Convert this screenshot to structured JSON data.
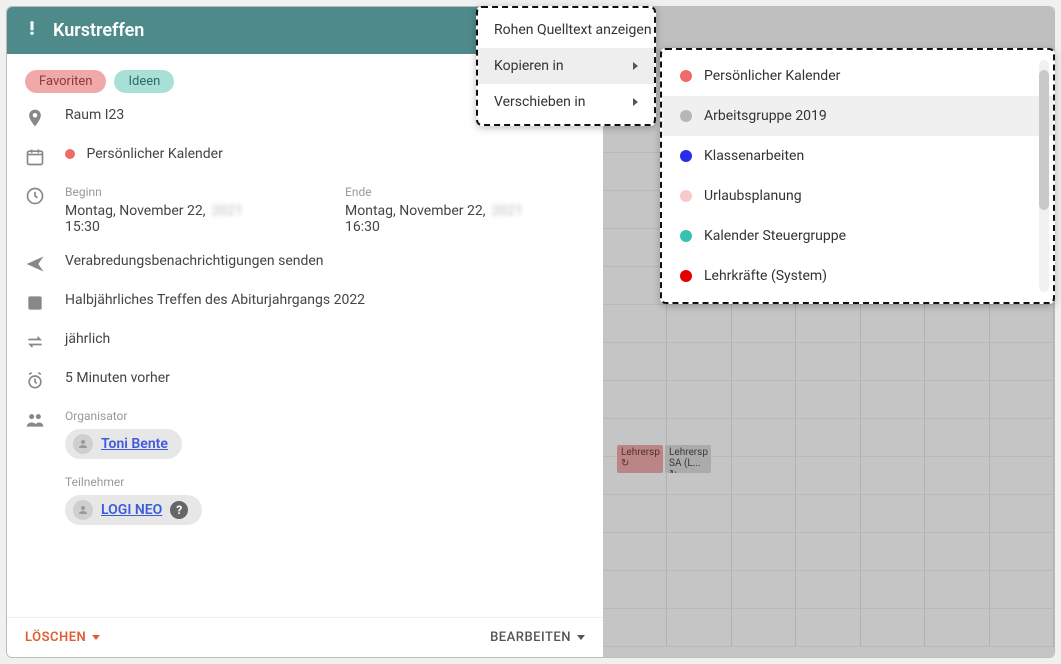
{
  "header": {
    "title": "Kurstreffen"
  },
  "tags": {
    "fav": "Favoriten",
    "idea": "Ideen"
  },
  "location": "Raum I23",
  "calendar": {
    "name": "Persönlicher Kalender",
    "color": "#f06a6a"
  },
  "time": {
    "begin_label": "Beginn",
    "end_label": "Ende",
    "begin_date": "Montag, November 22,",
    "begin_year_obscured": "2021",
    "begin_time": "15:30",
    "end_date": "Montag, November 22,",
    "end_year_obscured": "2021",
    "end_time": "16:30"
  },
  "notify_text": "Verabredungsbenachrichtigungen senden",
  "description": "Halbjährliches Treffen des Abiturjahrgangs 2022",
  "recurrence": "jährlich",
  "alarm": "5 Minuten vorher",
  "organizer_label": "Organisator",
  "organizer_name": "Toni Bente",
  "attendees_label": "Teilnehmer",
  "attendee_name": "LOGI NEO",
  "footer": {
    "delete": "LÖSCHEN",
    "edit": "BEARBEITEN"
  },
  "context_menu": {
    "show_source": "Rohen Quelltext anzeigen",
    "copy_to": "Kopieren in",
    "move_to": "Verschieben in"
  },
  "submenu_items": [
    {
      "label": "Persönlicher Kalender",
      "color": "#f06a6a"
    },
    {
      "label": "Arbeitsgruppe 2019",
      "color": "#b7b7b7"
    },
    {
      "label": "Klassenarbeiten",
      "color": "#2b2bea"
    },
    {
      "label": "Urlaubsplanung",
      "color": "#f8c9c9"
    },
    {
      "label": "Kalender Steuergruppe",
      "color": "#37c1b1"
    },
    {
      "label": "Lehrkräfte (System)",
      "color": "#e20000"
    }
  ],
  "bg_events": [
    {
      "label": "Lehrersp",
      "sub": ""
    },
    {
      "label": "Lehrersp",
      "sub": "SA (L..."
    }
  ]
}
